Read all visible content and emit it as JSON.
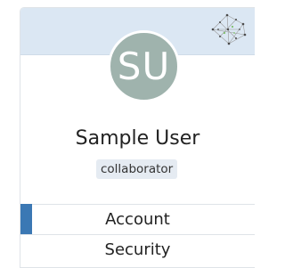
{
  "profile": {
    "avatar_initials": "SU",
    "name": "Sample User",
    "role": "collaborator",
    "banner_icon": "network-graph-icon"
  },
  "nav": {
    "items": [
      {
        "label": "Account",
        "active": true
      },
      {
        "label": "Security",
        "active": false
      }
    ]
  },
  "colors": {
    "banner": "#dbe7f3",
    "avatar": "#9fb3ad",
    "accent": "#3b78b4",
    "badge": "#e5ebf2"
  }
}
